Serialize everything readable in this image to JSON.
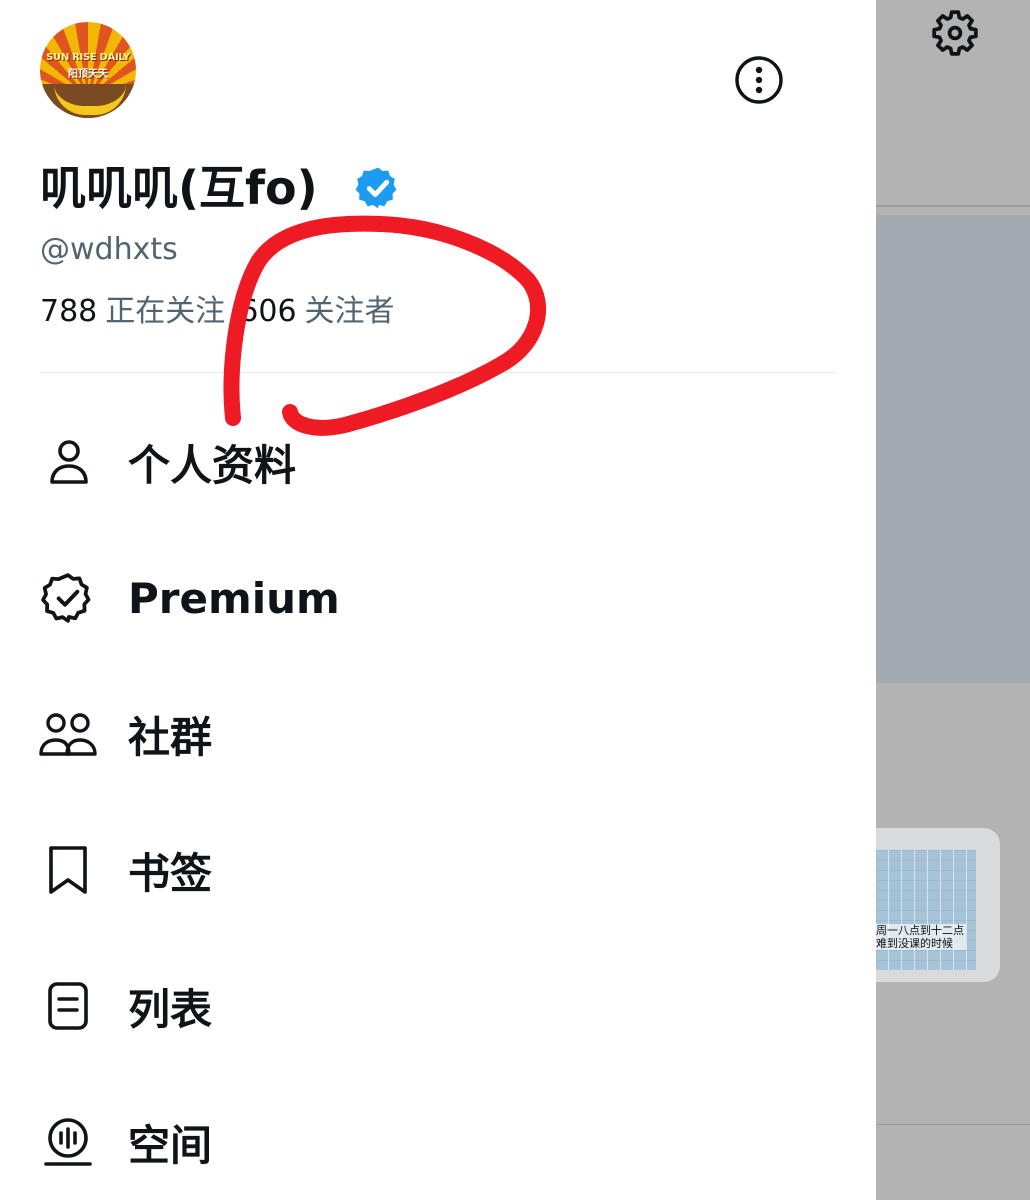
{
  "profile": {
    "avatar": {
      "title": "SUN RISE DAILY",
      "subtitle": "阳顶天天"
    },
    "display_name": "叽叽叽(互fo)",
    "handle": "@wdhxts",
    "following": {
      "count": "788",
      "label": "正在关注"
    },
    "followers": {
      "count": "606",
      "label": "关注者"
    }
  },
  "menu": [
    {
      "label": "个人资料",
      "icon": "person-icon"
    },
    {
      "label": "Premium",
      "icon": "verified-badge-icon"
    },
    {
      "label": "社群",
      "icon": "communities-icon"
    },
    {
      "label": "书签",
      "icon": "bookmark-icon"
    },
    {
      "label": "列表",
      "icon": "list-icon"
    },
    {
      "label": "空间",
      "icon": "spaces-icon"
    }
  ],
  "background_app": {
    "thumbnail_caption_line1": "周一八点到十二点",
    "thumbnail_caption_line2": "难到没课的时候"
  },
  "colors": {
    "verified": "#1d9bf0",
    "annotation": "#ee1b24",
    "secondary_text": "#536471",
    "overlay": "#b3b3b3"
  }
}
